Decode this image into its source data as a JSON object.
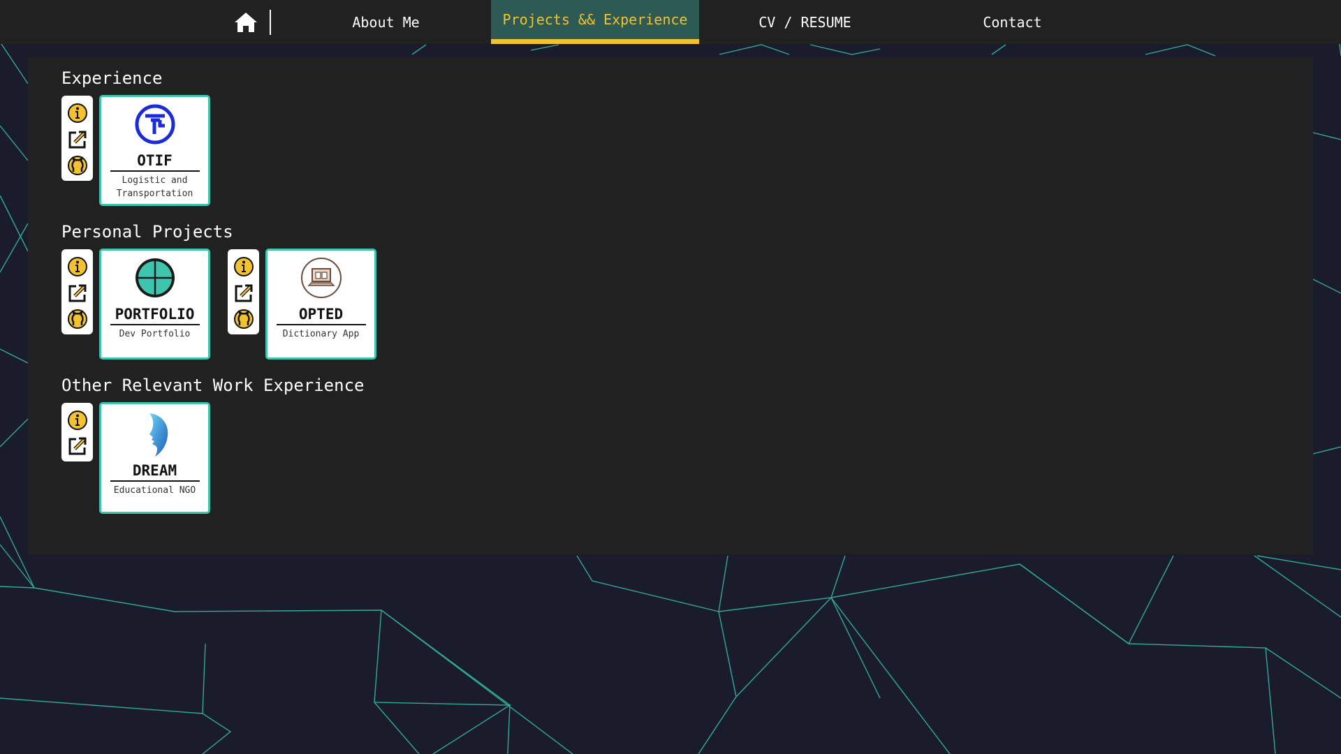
{
  "nav": {
    "home_icon": "home-icon",
    "items": [
      {
        "label": "About Me"
      },
      {
        "label": "Projects && Experience",
        "active": true
      },
      {
        "label": "CV / RESUME"
      },
      {
        "label": "Contact"
      }
    ]
  },
  "sections": [
    {
      "title": "Experience",
      "cards": [
        {
          "name": "OTIF",
          "subtitle": "Logistic and Transportation",
          "logo": "otif-logo",
          "actions": [
            "info-icon",
            "external-link-icon",
            "github-icon"
          ]
        }
      ]
    },
    {
      "title": "Personal Projects",
      "cards": [
        {
          "name": "PORTFOLIO",
          "subtitle": "Dev Portfolio",
          "logo": "crosshair-globe-logo",
          "actions": [
            "info-icon",
            "external-link-icon",
            "github-icon"
          ]
        },
        {
          "name": "OPTED",
          "subtitle": "Dictionary App",
          "logo": "laptop-book-logo",
          "actions": [
            "info-icon",
            "external-link-icon",
            "github-icon"
          ]
        }
      ]
    },
    {
      "title": "Other Relevant Work Experience",
      "cards": [
        {
          "name": "DREAM",
          "subtitle": "Educational NGO",
          "logo": "face-profile-logo",
          "actions": [
            "info-icon",
            "external-link-icon"
          ]
        }
      ]
    }
  ],
  "colors": {
    "accent": "#f2c230",
    "active_nav_bg": "#2e5a55",
    "card_border": "#3fc4ae",
    "panel_bg": "#212121",
    "page_bg": "#1b1c2b"
  }
}
